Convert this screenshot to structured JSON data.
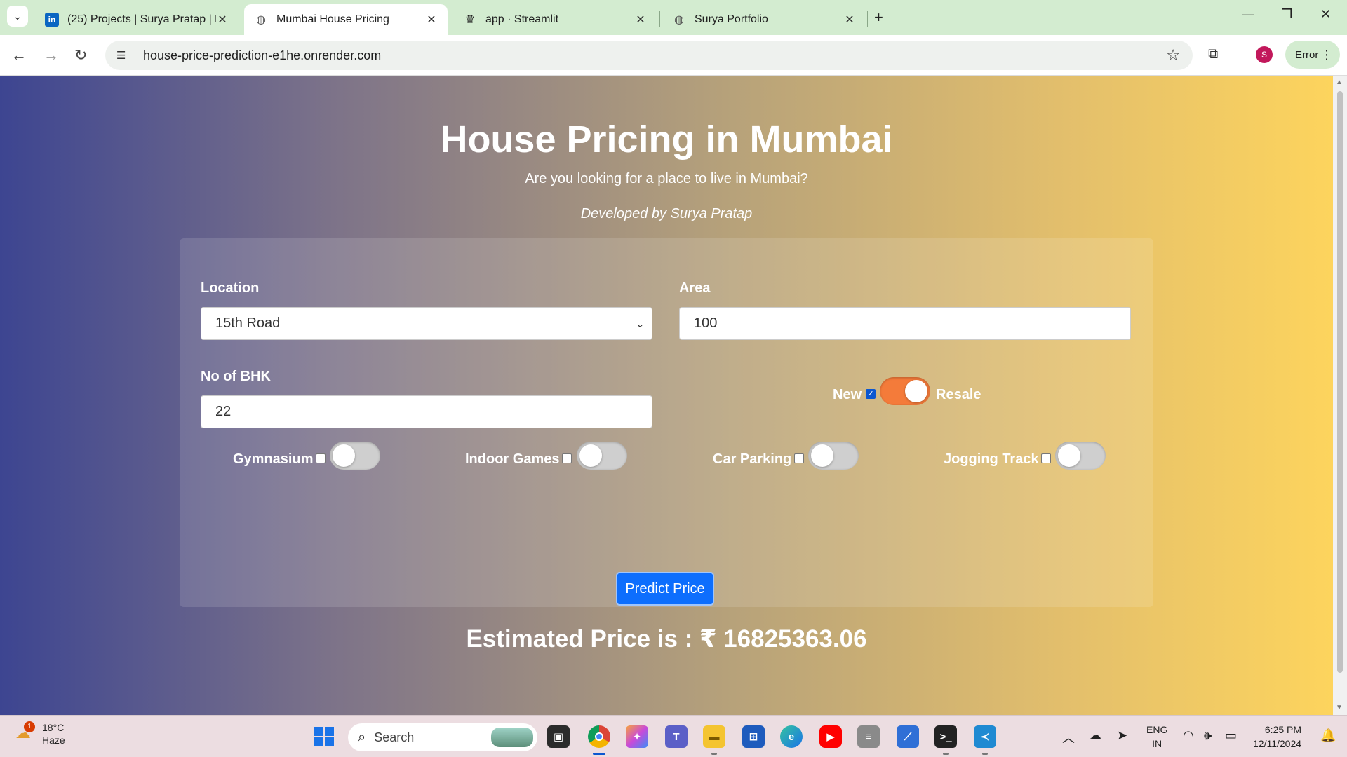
{
  "browser": {
    "tabs": [
      {
        "title": "(25) Projects | Surya Pratap | Lin",
        "icon": "linkedin-icon",
        "active": false
      },
      {
        "title": "Mumbai House Pricing",
        "icon": "globe-icon",
        "active": true
      },
      {
        "title": "app · Streamlit",
        "icon": "streamlit-icon",
        "active": false
      },
      {
        "title": "Surya Portfolio",
        "icon": "globe-icon",
        "active": false
      }
    ],
    "url": "house-price-prediction-e1he.onrender.com",
    "profile_initial": "S",
    "status_label": "Error"
  },
  "page": {
    "title": "House Pricing in Mumbai",
    "subtitle": "Are you looking for a place to live in Mumbai?",
    "developer": "Developed by Surya Pratap",
    "form": {
      "location_label": "Location",
      "location_value": "15th Road",
      "area_label": "Area",
      "area_value": "100",
      "bhk_label": "No of BHK",
      "bhk_value": "22",
      "new_label": "New",
      "resale_label": "Resale",
      "new_checked": true,
      "amenities": [
        {
          "label": "Gymnasium",
          "checked": false
        },
        {
          "label": "Indoor Games",
          "checked": false
        },
        {
          "label": "Car Parking",
          "checked": false
        },
        {
          "label": "Jogging Track",
          "checked": false
        }
      ],
      "predict_label": "Predict Price"
    },
    "result": "Estimated Price is : ₹ 16825363.06",
    "colors": {
      "gradient_start": "#3d4591",
      "gradient_end": "#fdd45d",
      "button": "#0d6efd",
      "toggle_on": "#f47b3a"
    }
  },
  "taskbar": {
    "weather_temp": "18°C",
    "weather_desc": "Haze",
    "weather_badge": "1",
    "search_placeholder": "Search",
    "lang_line1": "ENG",
    "lang_line2": "IN",
    "time": "6:25 PM",
    "date": "12/11/2024"
  }
}
